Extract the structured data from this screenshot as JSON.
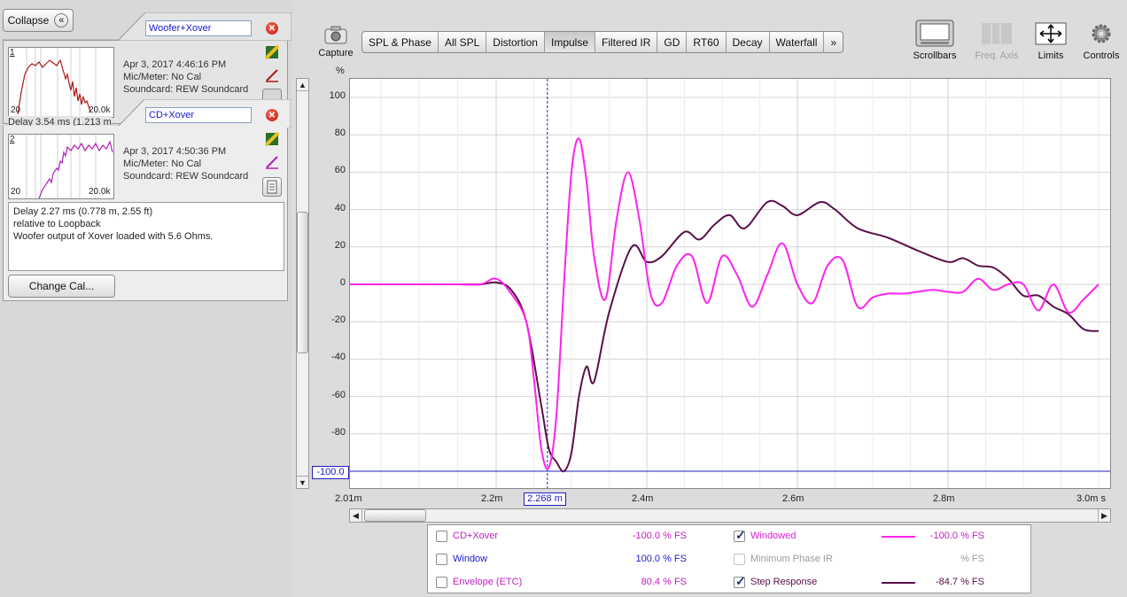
{
  "left_panel": {
    "collapse_label": "Collapse",
    "collapse_icon": "double-chevron-left-icon",
    "measurement1": {
      "index": "1",
      "name": "Woofer+Xover",
      "date": "Apr 3, 2017 4:46:16 PM",
      "mic": "Mic/Meter: No Cal",
      "soundcard": "Soundcard: REW Soundcard",
      "thumb_min": "20",
      "thumb_max": "20.0k",
      "delay_partial": "Delay 3.54 ms (1.213 m",
      "trace_color": "#b01818"
    },
    "measurement2": {
      "index": "2",
      "name": "CD+Xover",
      "date": "Apr 3, 2017 4:50:36 PM",
      "mic": "Mic/Meter: No Cal",
      "soundcard": "Soundcard: REW Soundcard",
      "thumb_min": "20",
      "thumb_max": "20.0k",
      "trace_color": "#b020b8",
      "notes": [
        "Delay 2.27 ms (0.778 m, 2.55 ft)",
        "relative to Loopback",
        "Woofer output of Xover loaded with 5.6 Ohms."
      ]
    },
    "change_cal_label": "Change Cal..."
  },
  "toolbar": {
    "capture_label": "Capture",
    "tabs": [
      "SPL & Phase",
      "All SPL",
      "Distortion",
      "Impulse",
      "Filtered IR",
      "GD",
      "RT60",
      "Decay",
      "Waterfall",
      "»"
    ],
    "active_tab": "Impulse",
    "scrollbars_label": "Scrollbars",
    "freq_axis_label": "Freq. Axis",
    "limits_label": "Limits",
    "controls_label": "Controls"
  },
  "plot": {
    "y_unit": "%",
    "cursor_y_readout": "-100.0",
    "cursor_x_readout": "2.268 m",
    "x_tick_labels": [
      "2.01m",
      "2.2m",
      "2.4m",
      "2.6m",
      "2.8m",
      "3.0m s"
    ],
    "y_tick_labels": [
      "100",
      "80",
      "60",
      "40",
      "20",
      "0",
      "-20",
      "-40",
      "-60",
      "-80"
    ]
  },
  "chart_data": {
    "type": "line",
    "xlabel": "s",
    "ylabel": "%",
    "xlim": [
      2.01,
      3.0
    ],
    "ylim": [
      -110,
      110
    ],
    "x_unit": "ms",
    "cursor": {
      "x": 2.268,
      "y": -100.0
    },
    "series": [
      {
        "name": "Windowed",
        "color": "#ff22ee",
        "x": [
          2.01,
          2.05,
          2.1,
          2.15,
          2.18,
          2.2,
          2.22,
          2.24,
          2.25,
          2.26,
          2.27,
          2.28,
          2.29,
          2.3,
          2.31,
          2.32,
          2.33,
          2.345,
          2.36,
          2.375,
          2.39,
          2.405,
          2.42,
          2.44,
          2.46,
          2.48,
          2.5,
          2.52,
          2.54,
          2.56,
          2.58,
          2.6,
          2.62,
          2.64,
          2.66,
          2.68,
          2.7,
          2.72,
          2.74,
          2.76,
          2.78,
          2.8,
          2.82,
          2.84,
          2.86,
          2.88,
          2.9,
          2.92,
          2.94,
          2.96,
          2.98,
          3.0
        ],
        "y": [
          0,
          0,
          0,
          0,
          0,
          3,
          -5,
          -20,
          -50,
          -88,
          -98,
          -70,
          0,
          60,
          78,
          55,
          15,
          -8,
          35,
          60,
          35,
          -5,
          -10,
          10,
          15,
          -10,
          15,
          5,
          -12,
          5,
          22,
          0,
          -10,
          10,
          13,
          -12,
          -7,
          -5,
          -5,
          -4,
          -3,
          -4,
          -4,
          3,
          -3,
          0,
          0,
          -14,
          0,
          -15,
          -8,
          0
        ]
      },
      {
        "name": "Step Response",
        "color": "#5a0f48",
        "x": [
          2.01,
          2.05,
          2.1,
          2.15,
          2.18,
          2.2,
          2.22,
          2.24,
          2.26,
          2.27,
          2.28,
          2.29,
          2.3,
          2.31,
          2.32,
          2.33,
          2.35,
          2.38,
          2.4,
          2.42,
          2.45,
          2.47,
          2.49,
          2.51,
          2.53,
          2.56,
          2.58,
          2.6,
          2.63,
          2.65,
          2.68,
          2.72,
          2.76,
          2.8,
          2.82,
          2.84,
          2.86,
          2.88,
          2.9,
          2.92,
          2.94,
          2.96,
          2.98,
          3.0
        ],
        "y": [
          0,
          0,
          0,
          0,
          0,
          1,
          -3,
          -20,
          -65,
          -88,
          -95,
          -100,
          -90,
          -60,
          -44,
          -52,
          -15,
          20,
          12,
          15,
          28,
          24,
          32,
          37,
          30,
          44,
          42,
          37,
          44,
          40,
          30,
          25,
          18,
          12,
          14,
          10,
          9,
          3,
          -6,
          -6,
          -12,
          -16,
          -24,
          -25
        ]
      }
    ]
  },
  "legend": {
    "left": [
      {
        "label": "CD+Xover",
        "value": "-100.0 % FS",
        "color": "#c020c0",
        "checked": false
      },
      {
        "label": "Window",
        "value": "100.0 % FS",
        "color": "#1a1acc",
        "checked": false
      },
      {
        "label": "Envelope (ETC)",
        "value": "80.4 % FS",
        "color": "#c020c0",
        "checked": false
      }
    ],
    "right": [
      {
        "label": "Windowed",
        "value": "-100.0 % FS",
        "color": "#ff22ee",
        "checked": true,
        "enabled": true
      },
      {
        "label": "Minimum Phase IR",
        "value": "% FS",
        "color": "#9a9a9a",
        "checked": false,
        "enabled": false
      },
      {
        "label": "Step Response",
        "value": "-84.7 % FS",
        "color": "#5a0f48",
        "checked": true,
        "enabled": true
      }
    ]
  }
}
